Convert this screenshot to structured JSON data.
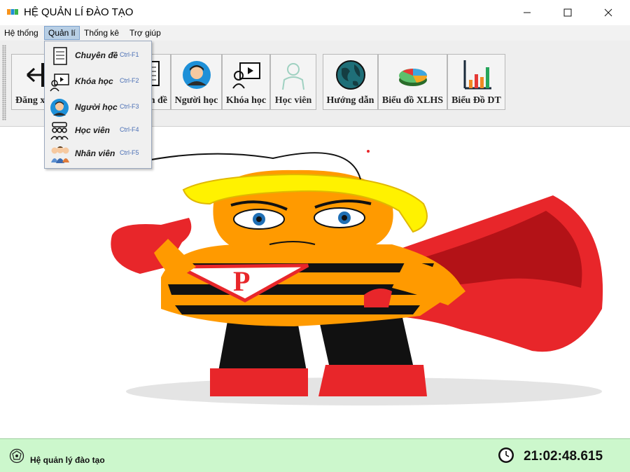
{
  "window": {
    "title": "HỆ QUẢN LÍ ĐÀO TẠO",
    "controls": [
      "minimize",
      "maximize",
      "close"
    ]
  },
  "menubar": {
    "items": [
      {
        "label": "Hệ thống"
      },
      {
        "label": "Quản lí"
      },
      {
        "label": "Thống kê"
      },
      {
        "label": "Trợ giúp"
      }
    ],
    "active": "Quản lí"
  },
  "dropdown": {
    "items": [
      {
        "label": "Chuyên đề",
        "shortcut": "Ctrl-F1",
        "icon": "document-icon"
      },
      {
        "label": "Khóa học",
        "shortcut": "Ctrl-F2",
        "icon": "video-course-icon"
      },
      {
        "label": "Người học",
        "shortcut": "Ctrl-F3",
        "icon": "learner-avatar-icon"
      },
      {
        "label": "Học viên",
        "shortcut": "Ctrl-F4",
        "icon": "students-group-icon"
      },
      {
        "label": "Nhân viên",
        "shortcut": "Ctrl-F5",
        "icon": "staff-icon"
      }
    ]
  },
  "toolbar": {
    "buttons": [
      {
        "label": "Đăng xuất",
        "icon": "logout-arrow-icon"
      },
      {
        "label": "Chuyên đề",
        "icon": "document-icon"
      },
      {
        "label": "Người học",
        "icon": "learner-avatar-icon"
      },
      {
        "label": "Khóa học",
        "icon": "video-course-icon"
      },
      {
        "label": "Học viên",
        "icon": "student-icon",
        "disabled": true
      },
      {
        "label": "Hướng dẫn",
        "icon": "globe-icon"
      },
      {
        "label": "Biểu đồ XLHS",
        "icon": "pie-chart-icon"
      },
      {
        "label": "Biểu Đồ DT",
        "icon": "bar-chart-icon"
      }
    ]
  },
  "main": {
    "image": "superhero-mascot-illustration"
  },
  "statusbar": {
    "text": "Hệ quản lý đào tạo",
    "clock": "21:02:48.615",
    "status_icon": "settings-badge-icon",
    "clock_icon": "clock-icon"
  },
  "colors": {
    "statusbar_bg": "#ccf7cc",
    "menu_active_bg": "#b8cfe5",
    "shortcut_text": "#4a6fb5",
    "hero_red": "#e8262a",
    "hero_yellow": "#fff200",
    "hero_orange": "#ff9a00"
  }
}
